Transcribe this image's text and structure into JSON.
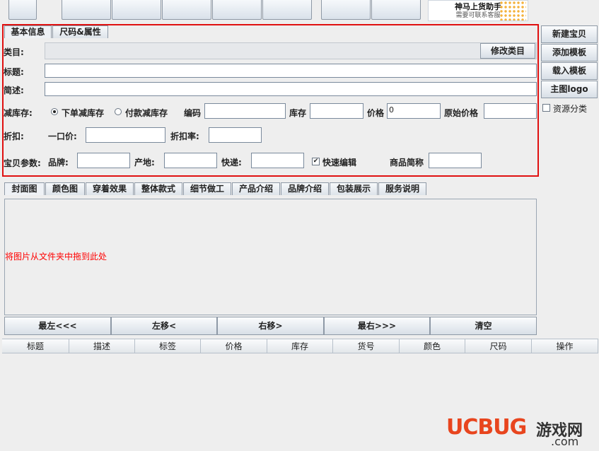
{
  "basic_tabs": [
    "基本信息",
    "尺码&属性"
  ],
  "form": {
    "category_label": "类目:",
    "modify_category": "修改类目",
    "title_label": "标题:",
    "desc_label": "简述:",
    "stock_label": "减库存:",
    "stock_option1": "下单减库存",
    "stock_option2": "付款减库存",
    "code_label": "编码",
    "qty_label": "库存",
    "price_label": "价格",
    "price_value": "0",
    "orig_price_label": "原始价格",
    "discount_label": "折扣:",
    "fixed_price_label": "一口价:",
    "discount_rate_label": "折扣率:",
    "params_label": "宝贝参数:",
    "brand_label": "品牌:",
    "origin_label": "产地:",
    "express_label": "快递:",
    "quick_edit_label": "快速编辑",
    "short_name_label": "商品简称"
  },
  "right_buttons": [
    "新建宝贝",
    "添加模板",
    "载入模板",
    "主图logo"
  ],
  "resource_category_label": "资源分类",
  "banner": {
    "line1": "神马上货助手",
    "line2": "需要可联系客服"
  },
  "image_tabs": [
    "封面图",
    "颜色图",
    "穿着效果",
    "整体款式",
    "细节做工",
    "产品介绍",
    "品牌介绍",
    "包装展示",
    "服务说明"
  ],
  "drop_hint": "将图片从文件夹中拖到此处",
  "move_buttons": [
    "最左<<<",
    "左移<",
    "右移>",
    "最右>>>",
    "清空"
  ],
  "table_headers": [
    "标题",
    "描述",
    "标签",
    "价格",
    "库存",
    "货号",
    "颜色",
    "尺码",
    "操作"
  ],
  "watermark": {
    "brand": "UCBUG",
    "suffix": "游戏网",
    "domain": ".com"
  }
}
